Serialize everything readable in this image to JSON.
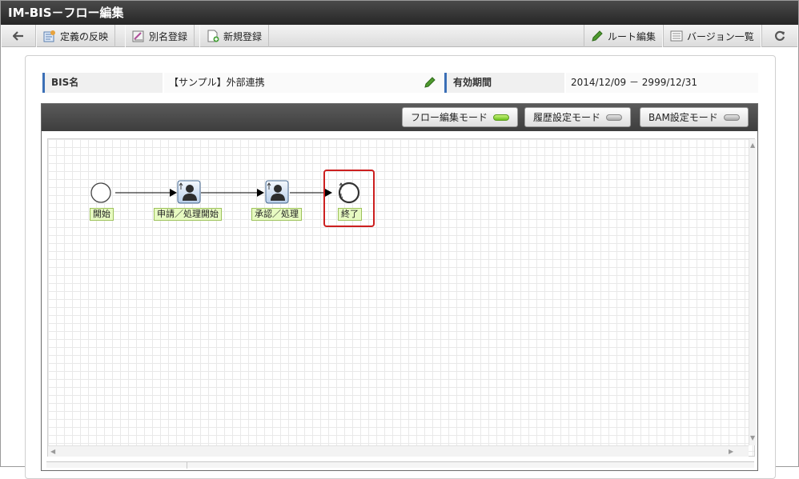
{
  "window": {
    "title": "IM-BIS－フロー編集"
  },
  "toolbar": {
    "back_label": "",
    "apply_label": "定義の反映",
    "alias_label": "別名登録",
    "new_label": "新規登録",
    "route_edit_label": "ルート編集",
    "version_list_label": "バージョン一覧",
    "refresh_label": ""
  },
  "info": {
    "bis_name_label": "BIS名",
    "bis_name_value": "【サンプル】外部連携",
    "valid_period_label": "有効期間",
    "valid_period_value": "2014/12/09 － 2999/12/31"
  },
  "modes": [
    {
      "label": "フロー編集モード",
      "active": true
    },
    {
      "label": "履歴設定モード",
      "active": false
    },
    {
      "label": "BAM設定モード",
      "active": false
    }
  ],
  "flow": {
    "nodes": [
      {
        "type": "start",
        "label": "開始"
      },
      {
        "type": "user-task",
        "label": "申請／処理開始"
      },
      {
        "type": "user-task",
        "label": "承認／処理"
      },
      {
        "type": "end",
        "label": "終了",
        "selected": true
      }
    ]
  },
  "colors": {
    "titlebar": "#2e2e2e",
    "accent": "#3b6fb6",
    "selection": "#cc1f1f",
    "mode_on": "#6cc21e",
    "node_label_bg": "#e7fac2"
  }
}
